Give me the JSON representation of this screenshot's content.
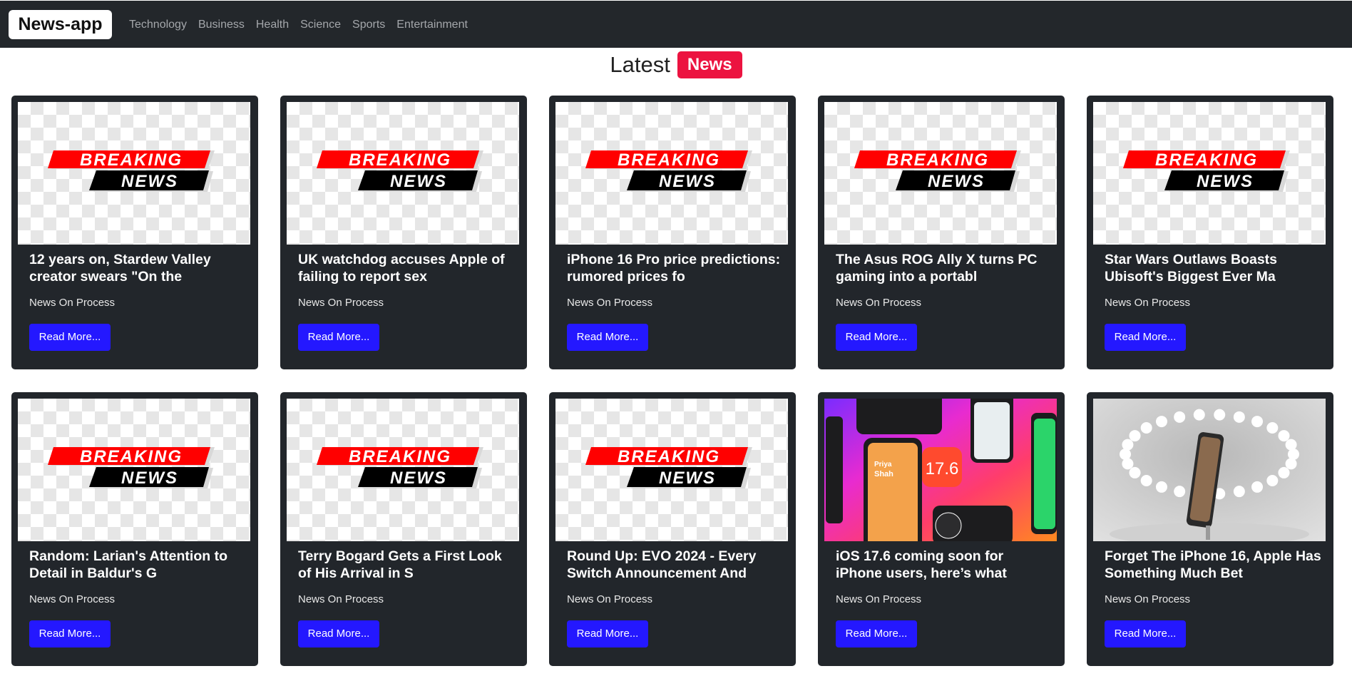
{
  "navbar": {
    "brand": "News-app",
    "links": [
      "Technology",
      "Business",
      "Health",
      "Science",
      "Sports",
      "Entertainment"
    ]
  },
  "heading": {
    "word": "Latest",
    "badge": "News"
  },
  "breaking_graphic": {
    "line1": "BREAKING",
    "line2": "NEWS"
  },
  "cards": [
    {
      "title": "12 years on, Stardew Valley creator swears \"On the",
      "source": "News On Process",
      "button": "Read More...",
      "image": "breaking-news"
    },
    {
      "title": "UK watchdog accuses Apple of failing to report sex",
      "source": "News On Process",
      "button": "Read More...",
      "image": "breaking-news"
    },
    {
      "title": "iPhone 16 Pro price predictions: rumored prices fo",
      "source": "News On Process",
      "button": "Read More...",
      "image": "breaking-news"
    },
    {
      "title": "The Asus ROG Ally X turns PC gaming into a portabl",
      "source": "News On Process",
      "button": "Read More...",
      "image": "breaking-news"
    },
    {
      "title": "Star Wars Outlaws Boasts Ubisoft's Biggest Ever Ma",
      "source": "News On Process",
      "button": "Read More...",
      "image": "breaking-news"
    },
    {
      "title": "Random: Larian's Attention to Detail in Baldur's G",
      "source": "News On Process",
      "button": "Read More...",
      "image": "breaking-news"
    },
    {
      "title": "Terry Bogard Gets a First Look of His Arrival in S",
      "source": "News On Process",
      "button": "Read More...",
      "image": "breaking-news"
    },
    {
      "title": "Round Up: EVO 2024 - Every Switch Announcement And",
      "source": "News On Process",
      "button": "Read More...",
      "image": "breaking-news"
    },
    {
      "title": "iOS 17.6 coming soon for iPhone users, here’s what",
      "source": "News On Process",
      "button": "Read More...",
      "image": "ios-promo"
    },
    {
      "title": "Forget The iPhone 16, Apple Has Something Much Bet",
      "source": "News On Process",
      "button": "Read More...",
      "image": "iphone-display"
    }
  ],
  "ios_graphic": {
    "badge": "17.6",
    "name_first": "Priya",
    "name_last": "Shah"
  },
  "colors": {
    "navbar": "#23272b",
    "badge": "#ec1340",
    "button": "#2418ff",
    "card": "#22262b"
  }
}
